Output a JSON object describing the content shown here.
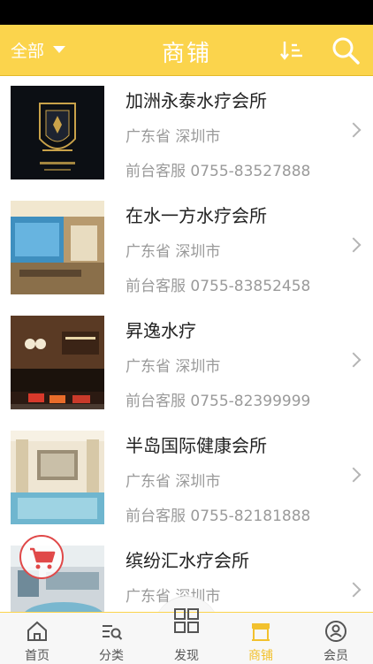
{
  "header": {
    "filter_label": "全部",
    "title": "商铺",
    "colors": {
      "bar": "#fbd44c",
      "text": "#ffffff"
    }
  },
  "shops": [
    {
      "name": "加洲永泰水疗会所",
      "location": "广东省 深圳市",
      "phone": "前台客服 0755-83527888"
    },
    {
      "name": "在水一方水疗会所",
      "location": "广东省 深圳市",
      "phone": "前台客服 0755-83852458"
    },
    {
      "name": "昇逸水疗",
      "location": "广东省 深圳市",
      "phone": "前台客服 0755-82399999"
    },
    {
      "name": "半岛国际健康会所",
      "location": "广东省 深圳市",
      "phone": "前台客服 0755-82181888"
    },
    {
      "name": "缤纷汇水疗会所",
      "location": "广东省 深圳市",
      "phone": ""
    }
  ],
  "bottom_nav": {
    "items": [
      {
        "label": "首页",
        "icon": "home-icon"
      },
      {
        "label": "分类",
        "icon": "category-icon"
      },
      {
        "label": "发现",
        "icon": "discover-grid-icon"
      },
      {
        "label": "商铺",
        "icon": "shop-icon",
        "active": true
      },
      {
        "label": "会员",
        "icon": "member-icon"
      }
    ],
    "active_color": "#f2c12e"
  }
}
